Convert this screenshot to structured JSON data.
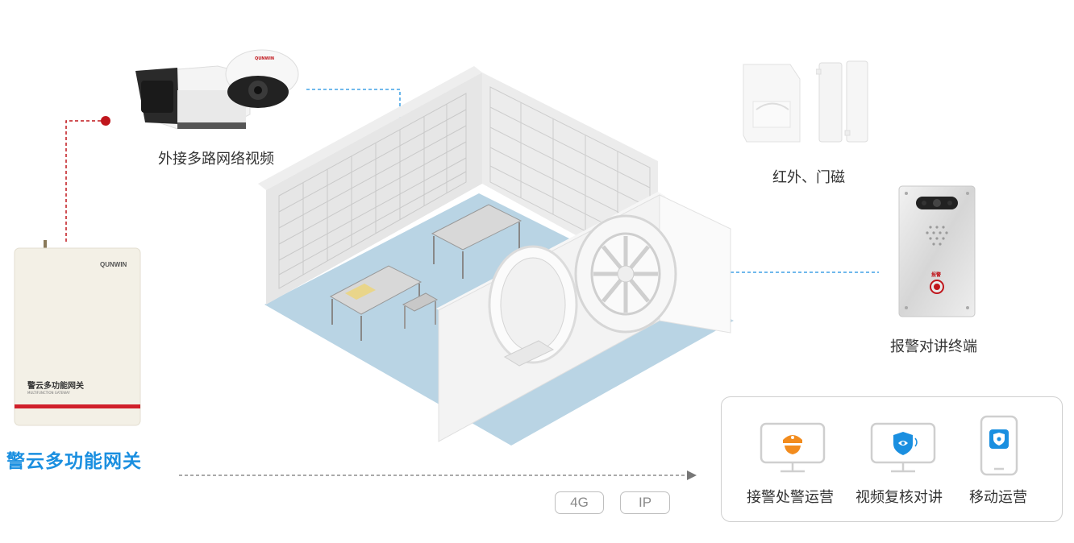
{
  "gateway": {
    "title": "警云多功能网关",
    "device_label_cn": "警云多功能网关",
    "device_label_en": "MULTIFUNCTION GATEWAY",
    "brand": "QUNWIN"
  },
  "devices": {
    "cameras_label": "外接多路网络视频",
    "sensors_label": "红外、门磁",
    "intercom_label": "报警对讲终端",
    "intercom_button_text": "报警"
  },
  "network": {
    "tags": [
      "4G",
      "IP"
    ]
  },
  "platform": {
    "items": [
      {
        "label": "接警处警运营",
        "icon": "police-badge-icon"
      },
      {
        "label": "视频复核对讲",
        "icon": "video-review-shield-icon"
      },
      {
        "label": "移动运营",
        "icon": "mobile-app-icon"
      }
    ]
  },
  "colors": {
    "accent_blue": "#1a8fe0",
    "connector_red": "#c0161c",
    "stripe_red": "#d0202a",
    "icon_orange": "#f28c1e",
    "floor_blue": "#b9d4e4"
  }
}
